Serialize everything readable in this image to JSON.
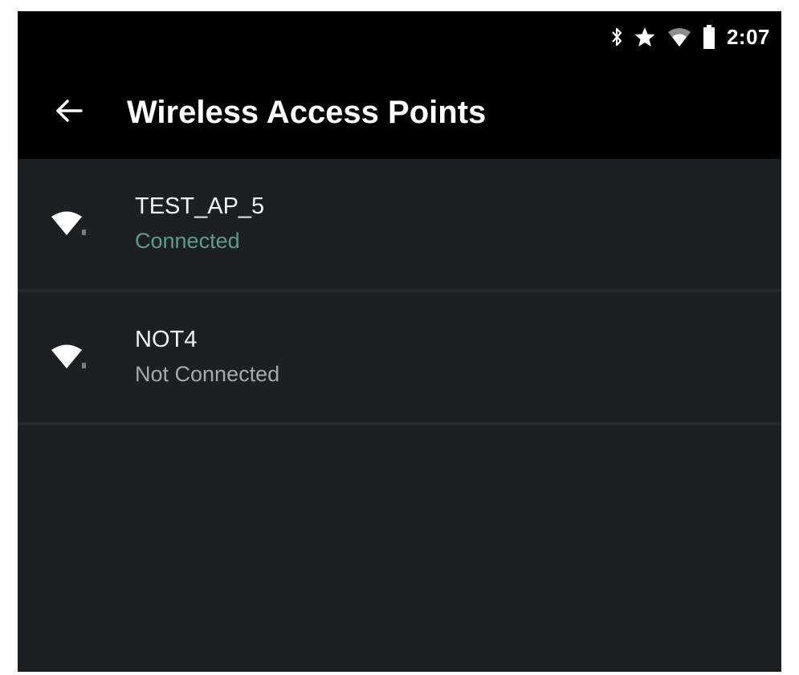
{
  "status_bar": {
    "time": "2:07",
    "icons": [
      "bluetooth-icon",
      "star-icon",
      "wifi-signal-icon",
      "battery-icon"
    ]
  },
  "app_bar": {
    "back_icon": "arrow-left-icon",
    "title": "Wireless Access Points"
  },
  "access_points": [
    {
      "name": "TEST_AP_5",
      "status": "Connected",
      "status_color": "#5e9b8e",
      "icon": "wifi-icon"
    },
    {
      "name": "NOT4",
      "status": "Not Connected",
      "status_color": "#a6a8aa",
      "icon": "wifi-icon"
    }
  ],
  "colors": {
    "background": "#1d2023",
    "bars": "#000000",
    "divider": "#262a2d",
    "accent_connected": "#5e9b8e"
  }
}
